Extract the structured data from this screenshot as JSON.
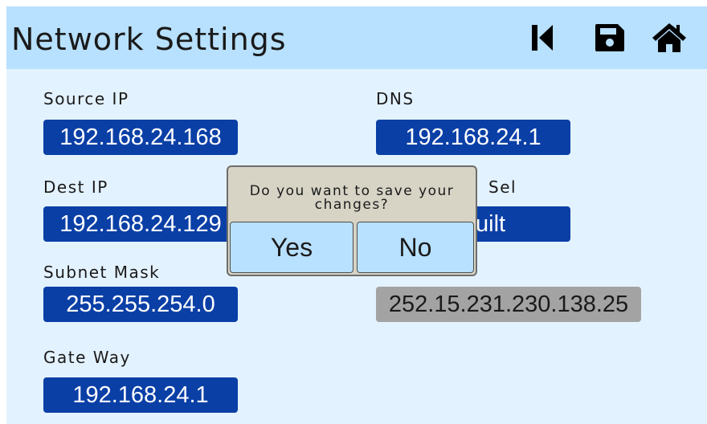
{
  "header": {
    "title": "Network Settings",
    "icons": [
      "skip-back-icon",
      "save-icon",
      "home-icon"
    ]
  },
  "fields": {
    "source_ip": {
      "label": "Source IP",
      "value": "192.168.24.168"
    },
    "dns": {
      "label": "DNS",
      "value": "192.168.24.1"
    },
    "dest_ip": {
      "label": "Dest IP",
      "value": "192.168.24.129"
    },
    "sel": {
      "label": "Sel",
      "value": "uilt"
    },
    "subnet_mask": {
      "label": "Subnet Mask",
      "value": "255.255.254.0"
    },
    "mac": {
      "value": "252.15.231.230.138.25"
    },
    "gateway": {
      "label": "Gate Way",
      "value": "192.168.24.1"
    }
  },
  "dialog": {
    "message_line1": "Do you want to save your",
    "message_line2": "changes?",
    "yes_label": "Yes",
    "no_label": "No"
  },
  "colors": {
    "header_bg": "#b8e0ff",
    "screen_bg": "#e3f2ff",
    "field_bg": "#0a3fa6",
    "field_disabled_bg": "#a3a3a3",
    "dialog_bg": "#d7d4c6"
  }
}
